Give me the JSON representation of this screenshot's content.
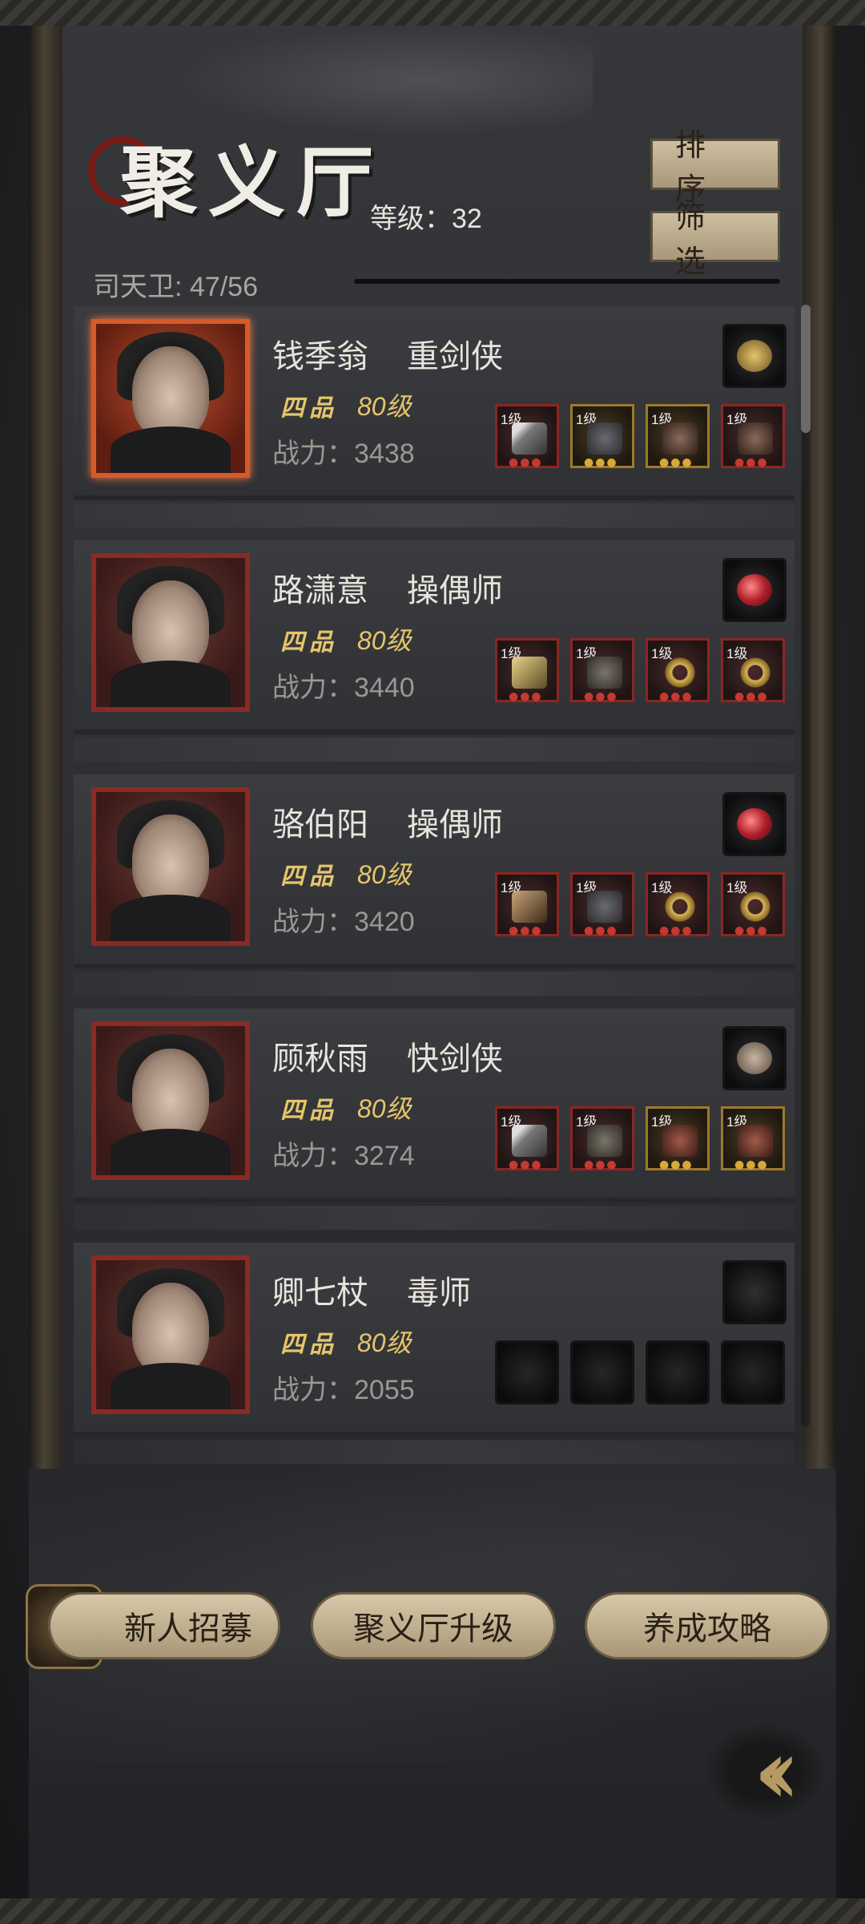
{
  "header": {
    "title": "聚义厅",
    "level_label": "等级：",
    "level_value": "32",
    "guard_label": "司天卫: 47/56",
    "sort_label": "排序",
    "filter_label": "筛选"
  },
  "characters": [
    {
      "name": "钱季翁",
      "class": "重剑侠",
      "rank": "四品",
      "level": "80级",
      "power_label": "战力：",
      "power": "3438",
      "portrait_frame": "orange",
      "pet_icon": "golden-cup-icon",
      "equipment": [
        {
          "tier": "1级",
          "icon": "sword-icon",
          "frame": "red"
        },
        {
          "tier": "1级",
          "icon": "armor-icon",
          "frame": "gold"
        },
        {
          "tier": "1级",
          "icon": "boots-icon",
          "frame": "gold"
        },
        {
          "tier": "1级",
          "icon": "boots-icon",
          "frame": "red"
        }
      ]
    },
    {
      "name": "路潇意",
      "class": "操偶师",
      "rank": "四品",
      "level": "80级",
      "power_label": "战力：",
      "power": "3440",
      "portrait_frame": "red",
      "pet_icon": "red-gem-icon",
      "equipment": [
        {
          "tier": "1级",
          "icon": "staff-icon",
          "frame": "red"
        },
        {
          "tier": "1级",
          "icon": "robe-icon",
          "frame": "red"
        },
        {
          "tier": "1级",
          "icon": "ring-icon",
          "frame": "red"
        },
        {
          "tier": "1级",
          "icon": "ring-icon",
          "frame": "red"
        }
      ]
    },
    {
      "name": "骆伯阳",
      "class": "操偶师",
      "rank": "四品",
      "level": "80级",
      "power_label": "战力：",
      "power": "3420",
      "portrait_frame": "red",
      "pet_icon": "red-gem-icon",
      "equipment": [
        {
          "tier": "1级",
          "icon": "crossbow-icon",
          "frame": "red"
        },
        {
          "tier": "1级",
          "icon": "armor-icon",
          "frame": "red"
        },
        {
          "tier": "1级",
          "icon": "ring-icon",
          "frame": "red"
        },
        {
          "tier": "1级",
          "icon": "ring-icon",
          "frame": "red"
        }
      ]
    },
    {
      "name": "顾秋雨",
      "class": "快剑侠",
      "rank": "四品",
      "level": "80级",
      "power_label": "战力：",
      "power": "3274",
      "portrait_frame": "red",
      "pet_icon": "rabbit-icon",
      "equipment": [
        {
          "tier": "1级",
          "icon": "sword-icon",
          "frame": "red"
        },
        {
          "tier": "1级",
          "icon": "robe-icon",
          "frame": "red"
        },
        {
          "tier": "1级",
          "icon": "mask-icon",
          "frame": "gold"
        },
        {
          "tier": "1级",
          "icon": "mask-icon",
          "frame": "gold"
        }
      ]
    },
    {
      "name": "卿七杖",
      "class": "毒师",
      "rank": "四品",
      "level": "80级",
      "power_label": "战力：",
      "power": "2055",
      "portrait_frame": "red",
      "pet_icon": "empty-slot-icon",
      "equipment": [
        {
          "tier": "",
          "icon": "empty-slot-icon",
          "frame": "empty"
        },
        {
          "tier": "",
          "icon": "empty-slot-icon",
          "frame": "empty"
        },
        {
          "tier": "",
          "icon": "empty-slot-icon",
          "frame": "empty"
        },
        {
          "tier": "",
          "icon": "empty-slot-icon",
          "frame": "empty"
        }
      ]
    }
  ],
  "footer": {
    "recruit_label": "新人招募",
    "upgrade_label": "聚义厅升级",
    "guide_label": "养成攻略",
    "back_icon": "double-chevron-left-icon"
  },
  "colors": {
    "rank_gold": "#e6c56a",
    "frame_red": "#8b2622",
    "frame_orange": "#d65a2a",
    "button_beige": "#cdbf9f"
  }
}
